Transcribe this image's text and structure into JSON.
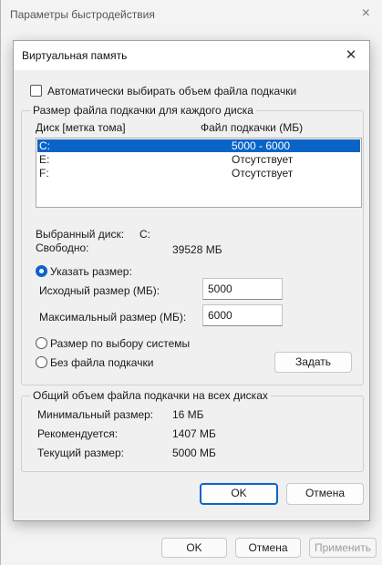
{
  "parent": {
    "title": "Параметры быстродействия",
    "close_icon": "×",
    "ok_label": "OK",
    "cancel_label": "Отмена",
    "apply_label": "Применить"
  },
  "dialog": {
    "title": "Виртуальная память",
    "close_icon": "✕",
    "auto_manage_label": "Автоматически выбирать объем файла подкачки",
    "auto_manage_checked": false,
    "per_drive": {
      "legend": "Размер файла подкачки для каждого диска",
      "col_drive": "Диск [метка тома]",
      "col_size": "Файл подкачки (МБ)",
      "drives": [
        {
          "drive": "C:",
          "size": "5000 - 6000",
          "selected": true
        },
        {
          "drive": "E:",
          "size": "Отсутствует",
          "selected": false
        },
        {
          "drive": "F:",
          "size": "Отсутствует",
          "selected": false
        }
      ],
      "selected_drive_label": "Выбранный диск:",
      "selected_drive_value": "C:",
      "free_label": "Свободно:",
      "free_value": "39528 МБ",
      "custom_size_label": "Указать размер:",
      "initial_size_label": "Исходный размер (МБ):",
      "initial_size_value": "5000",
      "max_size_label": "Максимальный размер (МБ):",
      "max_size_value": "6000",
      "system_managed_label": "Размер по выбору системы",
      "no_paging_label": "Без файла подкачки",
      "set_button_label": "Задать",
      "selected_option": "custom"
    },
    "total": {
      "legend": "Общий объем файла подкачки на всех дисках",
      "min_label": "Минимальный размер:",
      "min_value": "16 МБ",
      "recommended_label": "Рекомендуется:",
      "recommended_value": "1407 МБ",
      "current_label": "Текущий размер:",
      "current_value": "5000 МБ"
    },
    "ok_label": "OK",
    "cancel_label": "Отмена"
  },
  "colors": {
    "accent": "#0a64c8",
    "dialog_bg": "#f0f0f0",
    "titlebar_bg": "#ffffff"
  }
}
